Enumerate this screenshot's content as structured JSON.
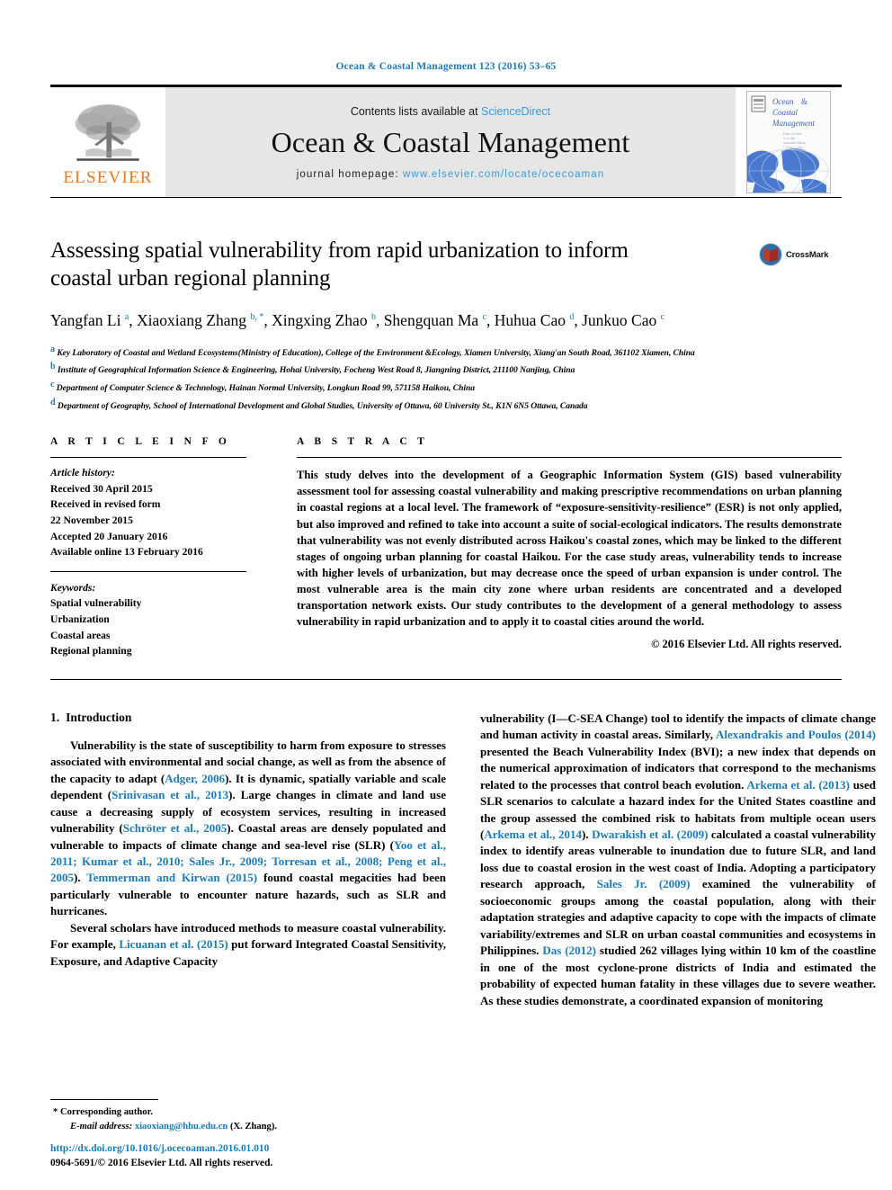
{
  "running_head": "Ocean & Coastal Management 123 (2016) 53–65",
  "masthead": {
    "publisher_name": "ELSEVIER",
    "contents_prefix": "Contents lists available at ",
    "contents_link": "ScienceDirect",
    "journal_title": "Ocean & Coastal Management",
    "homepage_prefix": "journal homepage: ",
    "homepage_url": "www.elsevier.com/locate/ocecoaman",
    "cover_title_line1": "Ocean &",
    "cover_title_line2": "Coastal",
    "cover_title_line3": "Management"
  },
  "crossmark": {
    "label": "CrossMark"
  },
  "article": {
    "title": "Assessing spatial vulnerability from rapid urbanization to inform coastal urban regional planning",
    "authors_html": "Yangfan Li <sup>a</sup>, Xiaoxiang Zhang <sup class=\"star\">b, *</sup>, Xingxing Zhao <sup>b</sup>, Shengquan Ma <sup>c</sup>, Huhua Cao <sup>d</sup>, Junkuo Cao <sup>c</sup>",
    "affiliations": [
      {
        "marker": "a",
        "text": "Key Laboratory of Coastal and Wetland Ecosystems(Ministry of Education), College of the Environment &Ecology, Xiamen University, Xiang'an South Road, 361102 Xiamen, China"
      },
      {
        "marker": "b",
        "text": "Institute of Geographical Information Science & Engineering, Hohai University, Focheng West Road 8, Jiangning District, 211100 Nanjing, China"
      },
      {
        "marker": "c",
        "text": "Department of Computer Science & Technology, Hainan Normal University, Longkun Road 99, 571158 Haikou, China"
      },
      {
        "marker": "d",
        "text": "Department of Geography, School of International Development and Global Studies, University of Ottawa, 60 University St., K1N 6N5 Ottawa, Canada"
      }
    ]
  },
  "article_info": {
    "heading": "A R T I C L E   I N F O",
    "history_label": "Article history:",
    "history": [
      "Received 30 April 2015",
      "Received in revised form",
      "22 November 2015",
      "Accepted 20 January 2016",
      "Available online 13 February 2016"
    ],
    "keywords_label": "Keywords:",
    "keywords": [
      "Spatial vulnerability",
      "Urbanization",
      "Coastal areas",
      "Regional planning"
    ]
  },
  "abstract": {
    "heading": "A B S T R A C T",
    "text": "This study delves into the development of a Geographic Information System (GIS) based vulnerability assessment tool for assessing coastal vulnerability and making prescriptive recommendations on urban planning in coastal regions at a local level. The framework of “exposure-sensitivity-resilience” (ESR) is not only applied, but also improved and refined to take into account a suite of social-ecological indicators. The results demonstrate that vulnerability was not evenly distributed across Haikou's coastal zones, which may be linked to the different stages of ongoing urban planning for coastal Haikou. For the case study areas, vulnerability tends to increase with higher levels of urbanization, but may decrease once the speed of urban expansion is under control. The most vulnerable area is the main city zone where urban residents are concentrated and a developed transportation network exists. Our study contributes to the development of a general methodology to assess vulnerability in rapid urbanization and to apply it to coastal cities around the world.",
    "copyright": "© 2016 Elsevier Ltd. All rights reserved."
  },
  "introduction": {
    "number": "1.",
    "title": "Introduction",
    "left_paragraphs_html": [
      "Vulnerability is the state of susceptibility to harm from exposure to stresses associated with environmental and social change, as well as from the absence of the capacity to adapt (<span class=\"cite\">Adger, 2006</span>). It is dynamic, spatially variable and scale dependent (<span class=\"cite\">Srinivasan et al., 2013</span>). Large changes in climate and land use cause a decreasing supply of ecosystem services, resulting in increased vulnerability (<span class=\"cite\">Schröter et al., 2005</span>). Coastal areas are densely populated and vulnerable to impacts of climate change and sea-level rise (SLR) (<span class=\"cite\">Yoo et al., 2011; Kumar et al., 2010; Sales Jr., 2009; Torresan et al., 2008; Peng et al., 2005</span>). <span class=\"cite\">Temmerman and Kirwan (2015)</span> found coastal megacities had been particularly vulnerable to encounter nature hazards, such as SLR and hurricanes.",
      "Several scholars have introduced methods to measure coastal vulnerability. For example, <span class=\"cite\">Licuanan et al. (2015)</span> put forward Integrated Coastal Sensitivity, Exposure, and Adaptive Capacity"
    ],
    "right_paragraphs_html": [
      "vulnerability (I—C-SEA Change) tool to identify the impacts of climate change and human activity in coastal areas. Similarly, <span class=\"cite\">Alexandrakis and Poulos (2014)</span> presented the Beach Vulnerability Index (BVI); a new index that depends on the numerical approximation of indicators that correspond to the mechanisms related to the processes that control beach evolution. <span class=\"cite\">Arkema et al. (2013)</span> used SLR scenarios to calculate a hazard index for the United States coastline and the group assessed the combined risk to habitats from multiple ocean users (<span class=\"cite\">Arkema et al., 2014</span>). <span class=\"cite\">Dwarakish et al. (2009)</span> calculated a coastal vulnerability index to identify areas vulnerable to inundation due to future SLR, and land loss due to coastal erosion in the west coast of India. Adopting a participatory research approach, <span class=\"cite\">Sales Jr. (2009)</span> examined the vulnerability of socioeconomic groups among the coastal population, along with their adaptation strategies and adaptive capacity to cope with the impacts of climate variability/extremes and SLR on urban coastal communities and ecosystems in Philippines. <span class=\"cite\">Das (2012)</span> studied 262 villages lying within 10 km of the coastline in one of the most cyclone-prone districts of India and estimated the probability of expected human fatality in these villages due to severe weather. As these studies demonstrate, a coordinated expansion of monitoring"
    ]
  },
  "footer": {
    "corresponding_marker": "*",
    "corresponding_label": "Corresponding author.",
    "email_label": "E-mail address:",
    "email": "xiaoxiang@hhu.edu.cn",
    "email_suffix": "(X. Zhang).",
    "doi": "http://dx.doi.org/10.1016/j.ocecoaman.2016.01.010",
    "issn_line": "0964-5691/© 2016 Elsevier Ltd. All rights reserved."
  },
  "colors": {
    "link_blue": "#1a7bb9",
    "science_direct_blue": "#3a9ad9",
    "elsevier_orange": "#e77924",
    "masthead_gray": "#e6e6e6",
    "crossmark_red": "#c0392b",
    "cover_blue": "#3f6fc4"
  }
}
